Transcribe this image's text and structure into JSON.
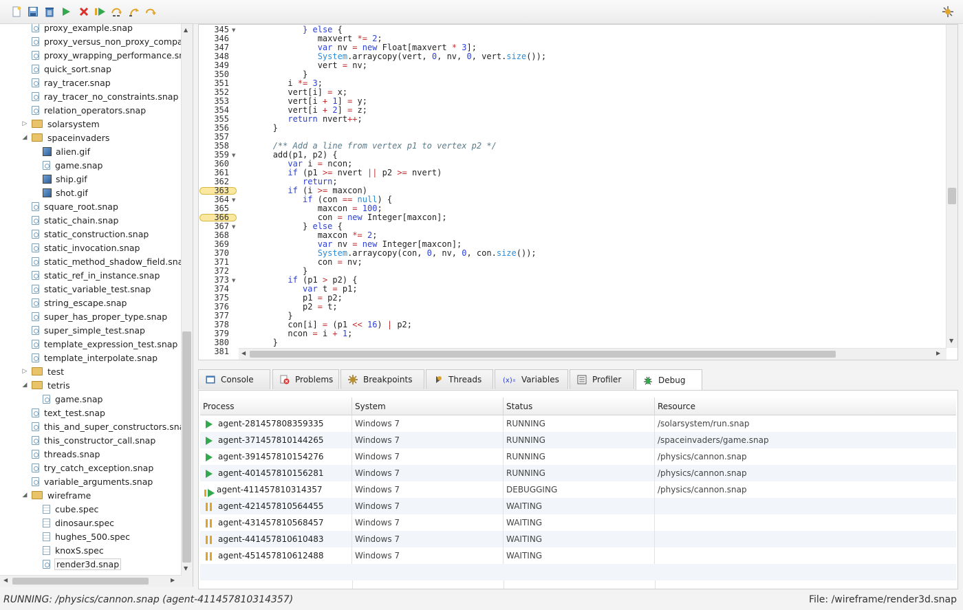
{
  "toolbar": {
    "buttons": [
      "new-file-icon",
      "save-icon",
      "delete-icon",
      "run-icon",
      "stop-icon",
      "resume-icon",
      "step-over-icon",
      "step-into-icon",
      "step-out-icon"
    ],
    "right_button": "debug-perspective-icon"
  },
  "tree": {
    "items": [
      {
        "label": "proxy_example.snap",
        "type": "file",
        "depth": 2
      },
      {
        "label": "proxy_versus_non_proxy_compar",
        "type": "file",
        "depth": 2
      },
      {
        "label": "proxy_wrapping_performance.sna",
        "type": "file",
        "depth": 2
      },
      {
        "label": "quick_sort.snap",
        "type": "file",
        "depth": 2
      },
      {
        "label": "ray_tracer.snap",
        "type": "file",
        "depth": 2
      },
      {
        "label": "ray_tracer_no_constraints.snap",
        "type": "file",
        "depth": 2
      },
      {
        "label": "relation_operators.snap",
        "type": "file",
        "depth": 2
      },
      {
        "label": "solarsystem",
        "type": "folder",
        "depth": 1,
        "expanded": false
      },
      {
        "label": "spaceinvaders",
        "type": "folder",
        "depth": 1,
        "expanded": true
      },
      {
        "label": "alien.gif",
        "type": "gif",
        "depth": 3
      },
      {
        "label": "game.snap",
        "type": "file",
        "depth": 3
      },
      {
        "label": "ship.gif",
        "type": "gif",
        "depth": 3
      },
      {
        "label": "shot.gif",
        "type": "gif",
        "depth": 3
      },
      {
        "label": "square_root.snap",
        "type": "file",
        "depth": 2
      },
      {
        "label": "static_chain.snap",
        "type": "file",
        "depth": 2
      },
      {
        "label": "static_construction.snap",
        "type": "file",
        "depth": 2
      },
      {
        "label": "static_invocation.snap",
        "type": "file",
        "depth": 2
      },
      {
        "label": "static_method_shadow_field.snap",
        "type": "file",
        "depth": 2
      },
      {
        "label": "static_ref_in_instance.snap",
        "type": "file",
        "depth": 2
      },
      {
        "label": "static_variable_test.snap",
        "type": "file",
        "depth": 2
      },
      {
        "label": "string_escape.snap",
        "type": "file",
        "depth": 2
      },
      {
        "label": "super_has_proper_type.snap",
        "type": "file",
        "depth": 2
      },
      {
        "label": "super_simple_test.snap",
        "type": "file",
        "depth": 2
      },
      {
        "label": "template_expression_test.snap",
        "type": "file",
        "depth": 2
      },
      {
        "label": "template_interpolate.snap",
        "type": "file",
        "depth": 2
      },
      {
        "label": "test",
        "type": "folder",
        "depth": 1,
        "expanded": false
      },
      {
        "label": "tetris",
        "type": "folder",
        "depth": 1,
        "expanded": true
      },
      {
        "label": "game.snap",
        "type": "file",
        "depth": 3
      },
      {
        "label": "text_test.snap",
        "type": "file",
        "depth": 2
      },
      {
        "label": "this_and_super_constructors.snap",
        "type": "file",
        "depth": 2
      },
      {
        "label": "this_constructor_call.snap",
        "type": "file",
        "depth": 2
      },
      {
        "label": "threads.snap",
        "type": "file",
        "depth": 2
      },
      {
        "label": "try_catch_exception.snap",
        "type": "file",
        "depth": 2
      },
      {
        "label": "variable_arguments.snap",
        "type": "file",
        "depth": 2
      },
      {
        "label": "wireframe",
        "type": "folder",
        "depth": 1,
        "expanded": true
      },
      {
        "label": "cube.spec",
        "type": "spec",
        "depth": 3
      },
      {
        "label": "dinosaur.spec",
        "type": "spec",
        "depth": 3
      },
      {
        "label": "hughes_500.spec",
        "type": "spec",
        "depth": 3
      },
      {
        "label": "knoxS.spec",
        "type": "spec",
        "depth": 3
      },
      {
        "label": "render3d.snap",
        "type": "file",
        "depth": 3,
        "selected": true
      }
    ]
  },
  "editor": {
    "lines": [
      {
        "n": "345",
        "fold": true,
        "html": "         <kw>}</kw> <kw>else</kw> {"
      },
      {
        "n": "346",
        "html": "            maxvert <op>*=</op> <num>2</num>;"
      },
      {
        "n": "347",
        "html": "            <kw>var</kw> nv <op>=</op> <kw>new</kw> Float[maxvert <op>*</op> <num>3</num>];"
      },
      {
        "n": "348",
        "html": "            <ty>System</ty>.arraycopy(vert, <num>0</num>, nv, <num>0</num>, vert.<ty>size</ty>());"
      },
      {
        "n": "349",
        "html": "            vert <op>=</op> nv;"
      },
      {
        "n": "350",
        "html": "         }"
      },
      {
        "n": "351",
        "html": "      i <op>*=</op> <num>3</num>;"
      },
      {
        "n": "352",
        "html": "      vert[i] <op>=</op> x;"
      },
      {
        "n": "353",
        "html": "      vert[i <op>+</op> <num>1</num>] <op>=</op> y;"
      },
      {
        "n": "354",
        "html": "      vert[i <op>+</op> <num>2</num>] <op>=</op> z;"
      },
      {
        "n": "355",
        "html": "      <kw>return</kw> nvert<op>++</op>;"
      },
      {
        "n": "356",
        "html": "   }"
      },
      {
        "n": "357",
        "html": ""
      },
      {
        "n": "358",
        "html": "   <cm>/** Add a line from vertex p1 to vertex p2 */</cm>"
      },
      {
        "n": "359",
        "fold": true,
        "html": "   <fn>add</fn>(p1, p2) {"
      },
      {
        "n": "360",
        "html": "      <kw>var</kw> i <op>=</op> ncon;"
      },
      {
        "n": "361",
        "html": "      <kw>if</kw> (p1 <op>&gt;=</op> nvert <op>||</op> p2 <op>&gt;=</op> nvert)"
      },
      {
        "n": "362",
        "html": "         <kw>return</kw>;"
      },
      {
        "n": "363",
        "bp": true,
        "html": "      <kw>if</kw> (i <op>&gt;=</op> maxcon)"
      },
      {
        "n": "364",
        "fold": true,
        "html": "         <kw>if</kw> (con <op>==</op> <ty>null</ty>) {"
      },
      {
        "n": "365",
        "html": "            maxcon <op>=</op> <num>100</num>;"
      },
      {
        "n": "366",
        "bp": true,
        "html": "            con <op>=</op> <kw>new</kw> Integer[maxcon];"
      },
      {
        "n": "367",
        "fold": true,
        "html": "         } <kw>else</kw> {"
      },
      {
        "n": "368",
        "html": "            maxcon <op>*=</op> <num>2</num>;"
      },
      {
        "n": "369",
        "html": "            <kw>var</kw> nv <op>=</op> <kw>new</kw> Integer[maxcon];"
      },
      {
        "n": "370",
        "html": "            <ty>System</ty>.arraycopy(con, <num>0</num>, nv, <num>0</num>, con.<ty>size</ty>());"
      },
      {
        "n": "371",
        "html": "            con <op>=</op> nv;"
      },
      {
        "n": "372",
        "html": "         }"
      },
      {
        "n": "373",
        "fold": true,
        "html": "      <kw>if</kw> (p1 <op>&gt;</op> p2) {"
      },
      {
        "n": "374",
        "html": "         <kw>var</kw> t <op>=</op> p1;"
      },
      {
        "n": "375",
        "html": "         p1 <op>=</op> p2;"
      },
      {
        "n": "376",
        "html": "         p2 <op>=</op> t;"
      },
      {
        "n": "377",
        "html": "      }"
      },
      {
        "n": "378",
        "html": "      con[i] <op>=</op> (p1 <op>&lt;&lt;</op> <num>16</num>) <op>|</op> p2;"
      },
      {
        "n": "379",
        "html": "      ncon <op>=</op> i <op>+</op> <num>1</num>;"
      },
      {
        "n": "380",
        "html": "   }"
      },
      {
        "n": "381",
        "html": ""
      }
    ]
  },
  "tabs": [
    {
      "label": "Console",
      "icon": "console-icon"
    },
    {
      "label": "Problems",
      "icon": "problems-icon"
    },
    {
      "label": "Breakpoints",
      "icon": "breakpoints-icon"
    },
    {
      "label": "Threads",
      "icon": "threads-icon"
    },
    {
      "label": "Variables",
      "icon": "variables-icon",
      "prefix": "(x)="
    },
    {
      "label": "Profiler",
      "icon": "profiler-icon"
    },
    {
      "label": "Debug",
      "icon": "debug-icon",
      "active": true
    }
  ],
  "debug_table": {
    "headers": [
      "Process",
      "System",
      "Status",
      "Resource"
    ],
    "rows": [
      {
        "process": "agent-281457808359335",
        "system": "Windows 7",
        "status": "RUNNING",
        "resource": "/solarsystem/run.snap",
        "state": "run"
      },
      {
        "process": "agent-371457810144265",
        "system": "Windows 7",
        "status": "RUNNING",
        "resource": "/spaceinvaders/game.snap",
        "state": "run"
      },
      {
        "process": "agent-391457810154276",
        "system": "Windows 7",
        "status": "RUNNING",
        "resource": "/physics/cannon.snap",
        "state": "run"
      },
      {
        "process": "agent-401457810156281",
        "system": "Windows 7",
        "status": "RUNNING",
        "resource": "/physics/cannon.snap",
        "state": "run"
      },
      {
        "process": "agent-411457810314357",
        "system": "Windows 7",
        "status": "DEBUGGING",
        "resource": "/physics/cannon.snap",
        "state": "debug"
      },
      {
        "process": "agent-421457810564455",
        "system": "Windows 7",
        "status": "WAITING",
        "resource": "",
        "state": "wait"
      },
      {
        "process": "agent-431457810568457",
        "system": "Windows 7",
        "status": "WAITING",
        "resource": "",
        "state": "wait"
      },
      {
        "process": "agent-441457810610483",
        "system": "Windows 7",
        "status": "WAITING",
        "resource": "",
        "state": "wait"
      },
      {
        "process": "agent-451457810612488",
        "system": "Windows 7",
        "status": "WAITING",
        "resource": "",
        "state": "wait"
      }
    ]
  },
  "status_bar": {
    "left": "RUNNING: /physics/cannon.snap (agent-411457810314357)",
    "right": "File: /wireframe/render3d.snap"
  },
  "colors": {
    "keyword": "#2a3fd6",
    "number": "#2a3fd6",
    "type": "#2a8bd6",
    "comment": "#5a7a8a",
    "run": "#34a84c",
    "wait": "#e0a42a",
    "breakpoint": "#fbe8a0"
  }
}
